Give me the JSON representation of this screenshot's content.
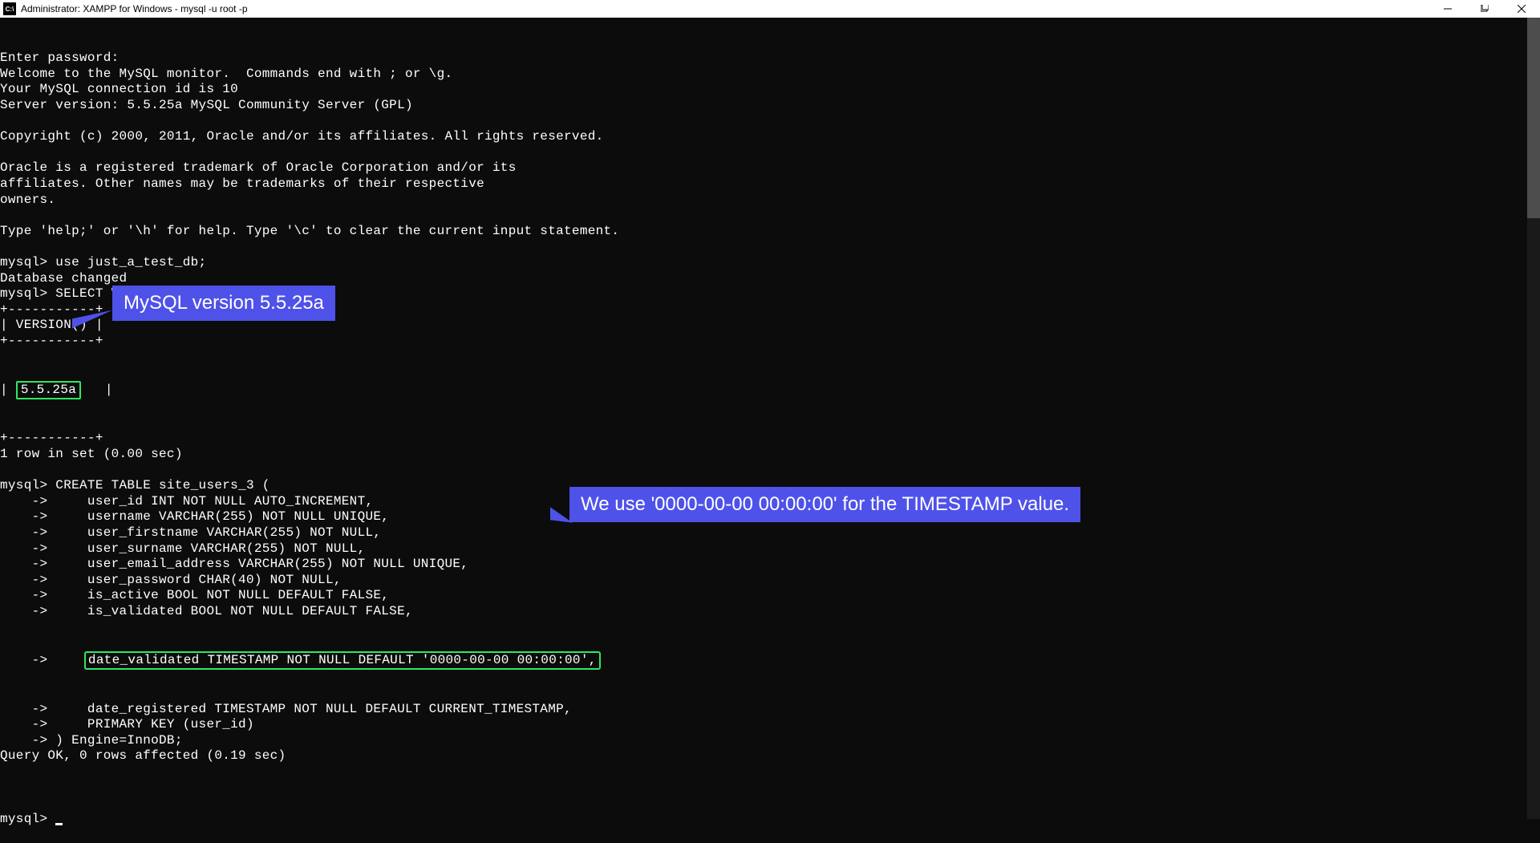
{
  "titlebar": {
    "text": "Administrator: XAMPP for Windows - mysql  -u root -p"
  },
  "terminal": {
    "lines": [
      "Enter password:",
      "Welcome to the MySQL monitor.  Commands end with ; or \\g.",
      "Your MySQL connection id is 10",
      "Server version: 5.5.25a MySQL Community Server (GPL)",
      "",
      "Copyright (c) 2000, 2011, Oracle and/or its affiliates. All rights reserved.",
      "",
      "Oracle is a registered trademark of Oracle Corporation and/or its",
      "affiliates. Other names may be trademarks of their respective",
      "owners.",
      "",
      "Type 'help;' or '\\h' for help. Type '\\c' to clear the current input statement.",
      "",
      "mysql> use just_a_test_db;",
      "Database changed",
      "mysql> SELECT VERSION();",
      "+-----------+",
      "| VERSION() |",
      "+-----------+"
    ],
    "version_row_prefix": "| ",
    "version_value": "5.5.25a",
    "version_row_suffix": "   |",
    "lines2": [
      "+-----------+",
      "1 row in set (0.00 sec)",
      "",
      "mysql> CREATE TABLE site_users_3 (",
      "    ->     user_id INT NOT NULL AUTO_INCREMENT,",
      "    ->     username VARCHAR(255) NOT NULL UNIQUE,",
      "    ->     user_firstname VARCHAR(255) NOT NULL,",
      "    ->     user_surname VARCHAR(255) NOT NULL,",
      "    ->     user_email_address VARCHAR(255) NOT NULL UNIQUE,",
      "    ->     user_password CHAR(40) NOT NULL,",
      "    ->     is_active BOOL NOT NULL DEFAULT FALSE,",
      "    ->     is_validated BOOL NOT NULL DEFAULT FALSE,"
    ],
    "highlight_line_prefix": "    ->     ",
    "highlight_line_content": "date_validated TIMESTAMP NOT NULL DEFAULT '0000-00-00 00:00:00',",
    "lines3": [
      "    ->     date_registered TIMESTAMP NOT NULL DEFAULT CURRENT_TIMESTAMP,",
      "    ->     PRIMARY KEY (user_id)",
      "    -> ) Engine=InnoDB;",
      "Query OK, 0 rows affected (0.19 sec)",
      ""
    ],
    "prompt": "mysql> "
  },
  "callouts": {
    "one": "MySQL version 5.5.25a",
    "two": "We use '0000-00-00 00:00:00' for the TIMESTAMP value."
  }
}
